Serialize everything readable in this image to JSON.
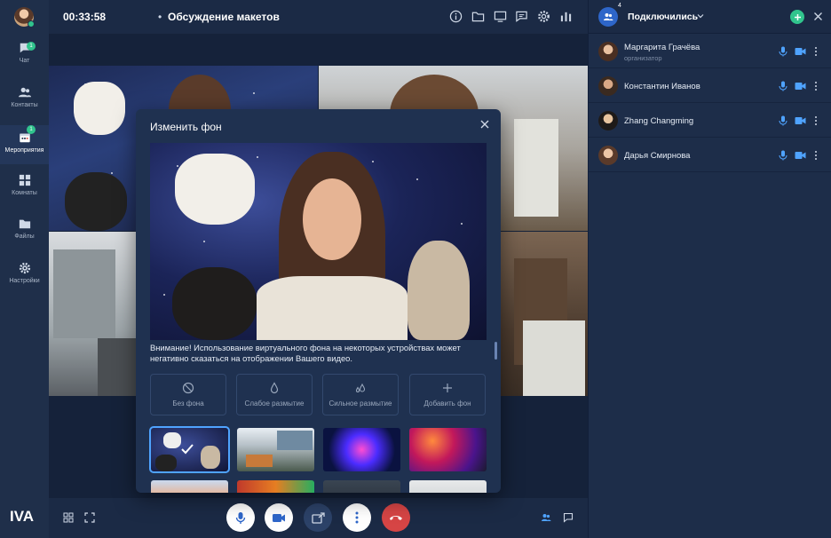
{
  "header": {
    "timer": "00:33:58",
    "separator": "•",
    "meeting_title": "Обсуждение макетов"
  },
  "sidebar": {
    "items": [
      {
        "label": "Чат",
        "badge": "1",
        "icon": "chat-icon"
      },
      {
        "label": "Контакты",
        "icon": "contacts-icon"
      },
      {
        "label": "Мероприятия",
        "badge": "1",
        "icon": "calendar-icon",
        "active": true
      },
      {
        "label": "Комнаты",
        "icon": "rooms-icon"
      },
      {
        "label": "Файлы",
        "icon": "folder-icon"
      },
      {
        "label": "Настройки",
        "icon": "gear-icon"
      }
    ],
    "logo": "IVA"
  },
  "modal": {
    "title": "Изменить фон",
    "warning": "Внимание! Использование виртуального фона на некоторых устройствах может негативно сказаться на отображении Вашего видео.",
    "options": [
      {
        "label": "Без фона",
        "icon": "no-background-icon"
      },
      {
        "label": "Слабое размытие",
        "icon": "weak-blur-icon"
      },
      {
        "label": "Сильное размытие",
        "icon": "strong-blur-icon"
      },
      {
        "label": "Добавить фон",
        "icon": "plus-icon"
      }
    ]
  },
  "participants_panel": {
    "title": "Подключились",
    "count": "4",
    "participants": [
      {
        "name": "Маргарита Грачёва",
        "role": "организатор"
      },
      {
        "name": "Константин Иванов"
      },
      {
        "name": "Zhang Changming"
      },
      {
        "name": "Дарья Смирнова"
      }
    ]
  },
  "colors": {
    "accent_green": "#31c48d",
    "accent_blue": "#2e66c9",
    "danger_red": "#d64545",
    "panel_bg": "#1d2d49"
  }
}
